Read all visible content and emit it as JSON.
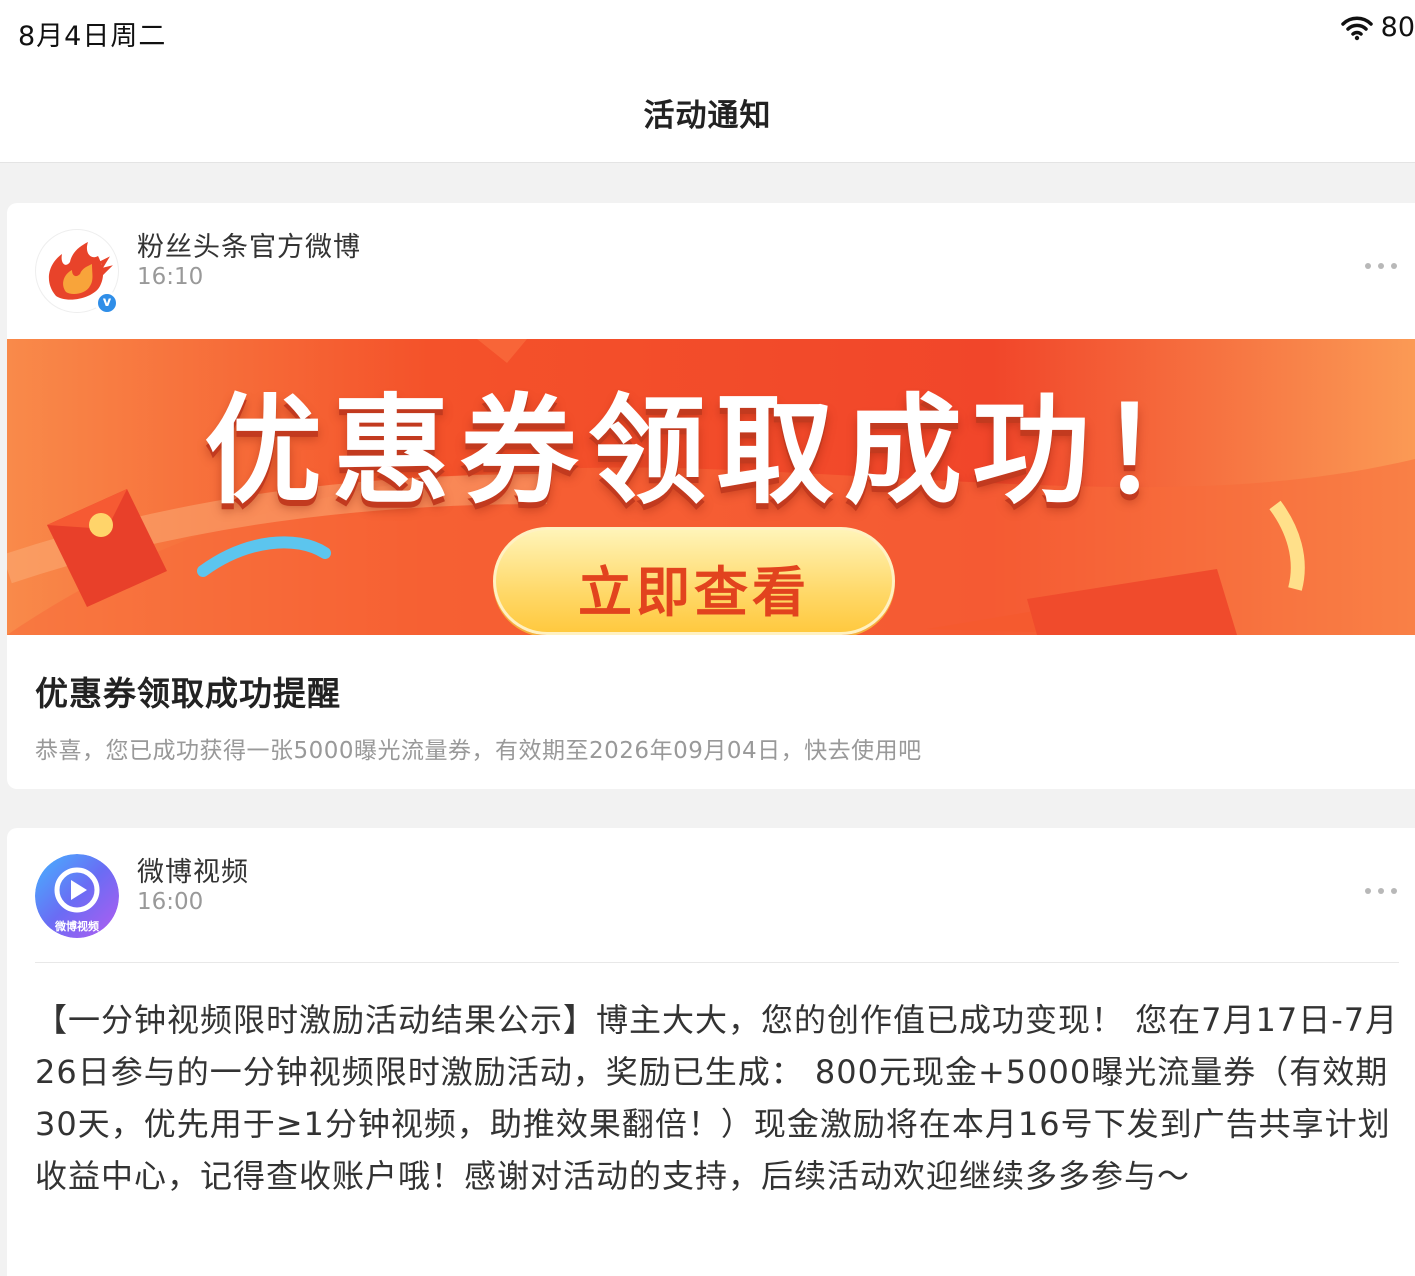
{
  "status_bar": {
    "time": "8月4日周二",
    "battery": "80"
  },
  "nav": {
    "title": "活动通知"
  },
  "notifications": [
    {
      "sender": "粉丝头条官方微博",
      "time": "16:10",
      "verified_mark": "v",
      "banner_title": "优惠券领取成功！",
      "banner_button": "立即查看",
      "title": "优惠券领取成功提醒",
      "description": "恭喜，您已成功获得一张5000曝光流量券，有效期至2026年09月04日，快去使用吧"
    },
    {
      "sender": "微博视频",
      "time": "16:00",
      "avatar_caption": "微博视频",
      "body": "【一分钟视频限时激励活动结果公示】博主大大，您的创作值已成功变现！ 您在7月17日-7月26日参与的一分钟视频限时激励活动，奖励已生成： 800元现金+5000曝光流量券（有效期30天，优先用于≥1分钟视频，助推效果翻倍！）现金激励将在本月16号下发到广告共享计划收益中心，记得查收账户哦！感谢对活动的支持，后续活动欢迎继续多多参与～"
    }
  ],
  "icons": {
    "wifi": "wifi-icon",
    "more": "more-icon",
    "verify": "verified-badge-icon",
    "play": "play-icon"
  },
  "colors": {
    "banner_orange": "#f2522a",
    "button_yellow": "#ffd96a",
    "button_text": "#e2431e",
    "verify_blue": "#2f8ee8",
    "video_purple": "#7b5cf0"
  }
}
